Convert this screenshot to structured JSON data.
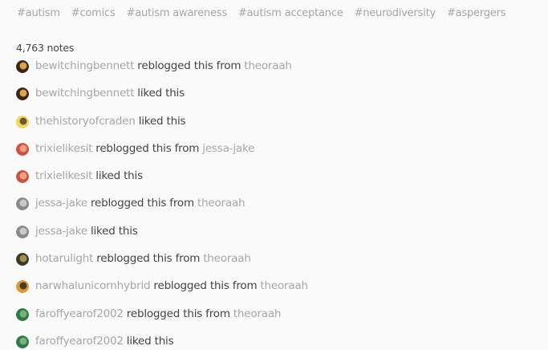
{
  "tags": [
    "#autism",
    "#comics",
    "#autism awareness",
    "#autism acceptance",
    "#neurodiversity",
    "#aspergers"
  ],
  "notes_count": "4,763 notes",
  "notes": [
    {
      "user": "bewitchingbennett",
      "action": "reblogged this from",
      "source": "theoraah",
      "avatar_colors": [
        "#3a2418",
        "#e0a24a"
      ]
    },
    {
      "user": "bewitchingbennett",
      "action": "liked this",
      "source": "",
      "avatar_colors": [
        "#3a2418",
        "#e0a24a"
      ]
    },
    {
      "user": "thehistoryofcraden",
      "action": "liked this",
      "source": "",
      "avatar_colors": [
        "#f3d65a",
        "#6a5a3a"
      ]
    },
    {
      "user": "trixielikesit",
      "action": "reblogged this from",
      "source": "jessa-jake",
      "avatar_colors": [
        "#c9553e",
        "#f0a080"
      ]
    },
    {
      "user": "trixielikesit",
      "action": "liked this",
      "source": "",
      "avatar_colors": [
        "#c9553e",
        "#f0a080"
      ]
    },
    {
      "user": "jessa-jake",
      "action": "reblogged this from",
      "source": "theoraah",
      "avatar_colors": [
        "#8a8a8a",
        "#c8c8c8"
      ]
    },
    {
      "user": "jessa-jake",
      "action": "liked this",
      "source": "",
      "avatar_colors": [
        "#8a8a8a",
        "#c8c8c8"
      ]
    },
    {
      "user": "hotarulight",
      "action": "reblogged this from",
      "source": "theoraah",
      "avatar_colors": [
        "#3a3a2a",
        "#a89048"
      ]
    },
    {
      "user": "narwhalunicornhybrid",
      "action": "reblogged this from",
      "source": "theoraah",
      "avatar_colors": [
        "#d89a3a",
        "#4a3a20"
      ]
    },
    {
      "user": "faroffyearof2002",
      "action": "reblogged this from",
      "source": "theoraah",
      "avatar_colors": [
        "#2f7a4a",
        "#7ab07a"
      ]
    },
    {
      "user": "faroffyearof2002",
      "action": "liked this",
      "source": "",
      "avatar_colors": [
        "#2f7a4a",
        "#7ab07a"
      ]
    }
  ]
}
